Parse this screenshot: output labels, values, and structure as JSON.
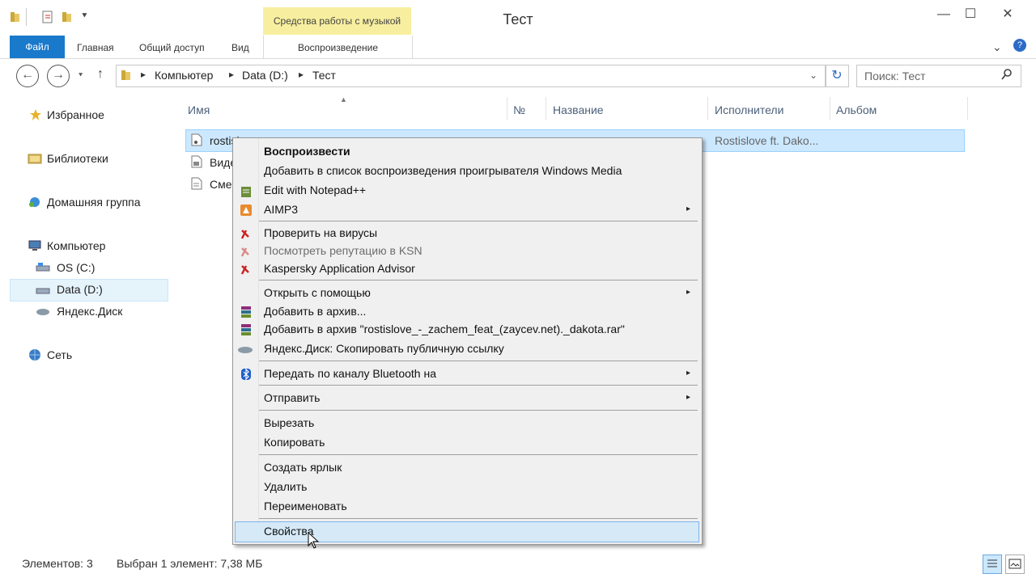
{
  "window": {
    "title": "Тест",
    "contextual_tab_header": "Средства работы с музыкой",
    "controls": {
      "minimize": "—",
      "maximize": "☐",
      "close": "✕"
    }
  },
  "ribbon": {
    "tabs": [
      {
        "label": "Файл"
      },
      {
        "label": "Главная"
      },
      {
        "label": "Общий доступ"
      },
      {
        "label": "Вид"
      },
      {
        "label": "Воспроизведение"
      }
    ]
  },
  "address": {
    "crumbs": [
      "Компьютер",
      "Data (D:)",
      "Тест"
    ],
    "search_placeholder": "Поиск: Тест"
  },
  "nav": {
    "favorites": "Избранное",
    "libraries": "Библиотеки",
    "homegroup": "Домашняя группа",
    "computer": "Компьютер",
    "drive_c": "OS (C:)",
    "drive_d": "Data (D:)",
    "yandex": "Яндекс.Диск",
    "network": "Сеть"
  },
  "columns": [
    "Имя",
    "№",
    "Название",
    "Исполнители",
    "Альбом"
  ],
  "files": [
    {
      "name": "rostisl",
      "artist": "Rostislove ft. Dako..."
    },
    {
      "name": "Виде"
    },
    {
      "name": "Сме"
    }
  ],
  "menu": {
    "play": "Воспроизвести",
    "add_to_playlist": "Добавить в список воспроизведения проигрывателя Windows Media",
    "notepad": "Edit with Notepad++",
    "aimp": "AIMP3",
    "scan": "Проверить на вирусы",
    "ksn": "Посмотреть репутацию в KSN",
    "kaspersky_advisor": "Kaspersky Application Advisor",
    "open_with": "Открыть с помощью",
    "add_archive": "Добавить в архив...",
    "add_archive_named": "Добавить в архив \"rostislove_-_zachem_feat_(zaycev.net)._dakota.rar\"",
    "yandex_link": "Яндекс.Диск: Скопировать публичную ссылку",
    "bluetooth": "Передать по каналу Bluetooth на",
    "send_to": "Отправить",
    "cut": "Вырезать",
    "copy": "Копировать",
    "create_shortcut": "Создать ярлык",
    "delete": "Удалить",
    "rename": "Переименовать",
    "properties": "Свойства",
    "submenu_arrow": "▸"
  },
  "status": {
    "items": "Элементов: 3",
    "selected": "Выбран 1 элемент: 7,38 МБ"
  },
  "colors": {
    "accent": "#1979ca",
    "contextual": "#f7ef9f",
    "selection": "#cce8ff"
  }
}
